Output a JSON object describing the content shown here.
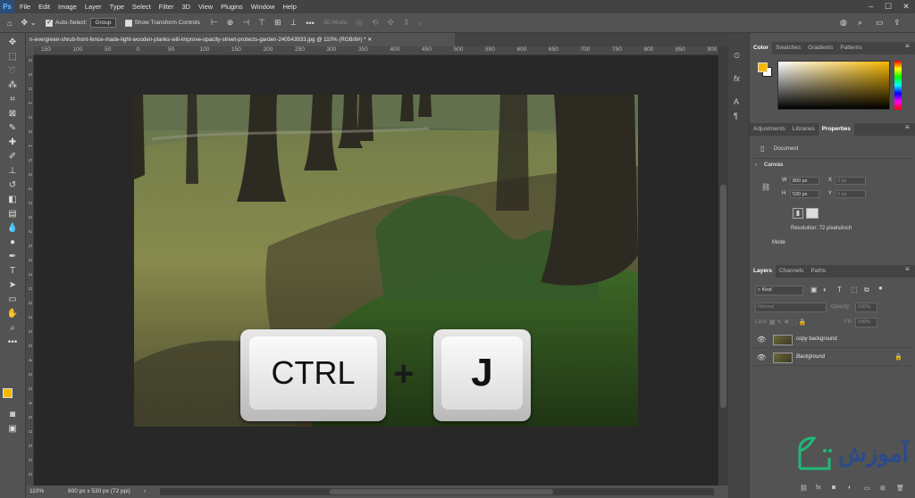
{
  "menubar": {
    "logo": "Ps",
    "items": [
      "File",
      "Edit",
      "Image",
      "Layer",
      "Type",
      "Select",
      "Filter",
      "3D",
      "View",
      "Plugins",
      "Window",
      "Help"
    ]
  },
  "options_bar": {
    "auto_select_label": "Auto-Select:",
    "auto_select_value": "Group",
    "show_transform_label": "Show Transform Controls",
    "mode_3d_label": "3D Mode:"
  },
  "document": {
    "tab_title": "n-evergreen-shrub-front-fence-made-light-wooden-planks-will-improve-opacity-street-protects-garden-240543933.jpg @ 110% (RGB/8#) *",
    "ruler_top": [
      "150",
      "100",
      "50",
      "0",
      "50",
      "100",
      "150",
      "200",
      "250",
      "300",
      "350",
      "400",
      "450",
      "500",
      "550",
      "600",
      "650",
      "700",
      "750",
      "800",
      "850",
      "900"
    ],
    "ruler_left": [
      "0",
      "5",
      "0",
      "1",
      "0",
      "0",
      "1",
      "5",
      "0",
      "2",
      "0",
      "0",
      "2",
      "5",
      "0",
      "3",
      "0",
      "0",
      "3",
      "5",
      "0",
      "4",
      "0",
      "0",
      "4",
      "5",
      "0",
      "5",
      "0",
      "0"
    ]
  },
  "status_bar": {
    "zoom": "110%",
    "doc_info": "800 px x 530 px (72 ppi)"
  },
  "keys": {
    "ctrl": "CTRL",
    "plus": "+",
    "j": "J"
  },
  "color_panel": {
    "tabs": [
      "Color",
      "Swatches",
      "Gradients",
      "Patterns"
    ],
    "active_tab": "Color",
    "foreground": "#f5b800",
    "background": "#ffffff"
  },
  "properties_panel": {
    "tabs": [
      "Adjustments",
      "Libraries",
      "Properties"
    ],
    "active_tab": "Properties",
    "document_label": "Document",
    "canvas_label": "Canvas",
    "w_label": "W",
    "w_value": "800 px",
    "h_label": "H",
    "h_value": "530 px",
    "x_label": "X",
    "x_placeholder": "0 px",
    "y_label": "Y",
    "y_placeholder": "0 px",
    "resolution": "Resolution: 72 pixels/inch",
    "mode_label": "Mode"
  },
  "layers_panel": {
    "tabs": [
      "Layers",
      "Channels",
      "Paths"
    ],
    "active_tab": "Layers",
    "kind_label": "Kind",
    "blend_mode": "Normal",
    "opacity_label": "Opacity:",
    "opacity_value": "100%",
    "lock_label": "Lock:",
    "fill_label": "Fill:",
    "fill_value": "100%",
    "layers": [
      {
        "name": "copy background"
      },
      {
        "name": "Background"
      }
    ]
  },
  "watermark": {
    "text": "آموزش"
  }
}
